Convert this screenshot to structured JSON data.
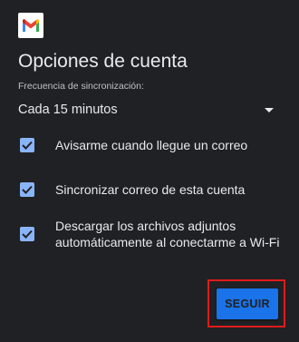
{
  "app": {
    "logo_icon": "gmail-logo",
    "accent_color": "#8ab4f8",
    "button_color": "#1a73e8",
    "highlight_color": "#e01b1b"
  },
  "header": {
    "title": "Opciones de cuenta"
  },
  "sync": {
    "label": "Frecuencia de sincronización:",
    "value": "Cada 15 minutos"
  },
  "options": [
    {
      "label": "Avisarme cuando llegue un correo",
      "checked": true
    },
    {
      "label": "Sincronizar correo de esta cuenta",
      "checked": true
    },
    {
      "label_line1": "Descargar los archivos adjuntos",
      "label_line2": "automáticamente al conectarme a Wi-Fi",
      "checked": true
    }
  ],
  "footer": {
    "next_label": "SEGUIR"
  }
}
